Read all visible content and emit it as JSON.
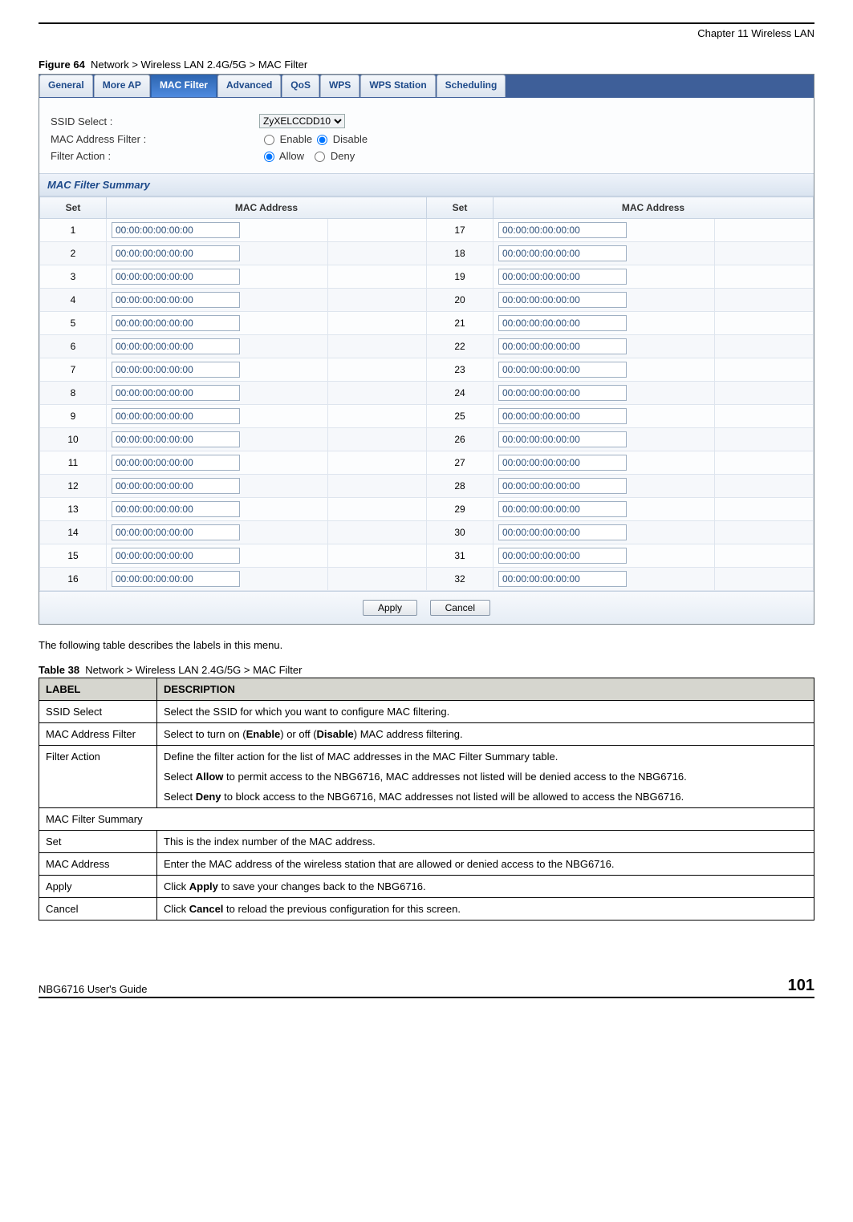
{
  "page": {
    "chapter": "Chapter 11 Wireless LAN",
    "figure_label": "Figure 64",
    "figure_caption": "Network > Wireless LAN 2.4G/5G > MAC Filter",
    "intro_text": "The following table describes the labels in this menu.",
    "table_label": "Table 38",
    "table_caption": "Network > Wireless LAN 2.4G/5G > MAC Filter",
    "footer_left": "NBG6716 User's Guide",
    "page_number": "101"
  },
  "screenshot": {
    "tabs": [
      "General",
      "More AP",
      "MAC Filter",
      "Advanced",
      "QoS",
      "WPS",
      "WPS Station",
      "Scheduling"
    ],
    "active_tab_index": 2,
    "labels": {
      "ssid_select": "SSID Select :",
      "mac_filter": "MAC Address Filter :",
      "filter_action": "Filter Action :",
      "enable": "Enable",
      "disable": "Disable",
      "allow": "Allow",
      "deny": "Deny"
    },
    "ssid_value": "ZyXELCCDD10",
    "mac_filter_value": "Disable",
    "filter_action_value": "Allow",
    "section_title": "MAC Filter Summary",
    "columns": {
      "set": "Set",
      "mac": "MAC Address"
    },
    "mac_rows": [
      {
        "a_set": "1",
        "a_mac": "00:00:00:00:00:00",
        "b_set": "17",
        "b_mac": "00:00:00:00:00:00"
      },
      {
        "a_set": "2",
        "a_mac": "00:00:00:00:00:00",
        "b_set": "18",
        "b_mac": "00:00:00:00:00:00"
      },
      {
        "a_set": "3",
        "a_mac": "00:00:00:00:00:00",
        "b_set": "19",
        "b_mac": "00:00:00:00:00:00"
      },
      {
        "a_set": "4",
        "a_mac": "00:00:00:00:00:00",
        "b_set": "20",
        "b_mac": "00:00:00:00:00:00"
      },
      {
        "a_set": "5",
        "a_mac": "00:00:00:00:00:00",
        "b_set": "21",
        "b_mac": "00:00:00:00:00:00"
      },
      {
        "a_set": "6",
        "a_mac": "00:00:00:00:00:00",
        "b_set": "22",
        "b_mac": "00:00:00:00:00:00"
      },
      {
        "a_set": "7",
        "a_mac": "00:00:00:00:00:00",
        "b_set": "23",
        "b_mac": "00:00:00:00:00:00"
      },
      {
        "a_set": "8",
        "a_mac": "00:00:00:00:00:00",
        "b_set": "24",
        "b_mac": "00:00:00:00:00:00"
      },
      {
        "a_set": "9",
        "a_mac": "00:00:00:00:00:00",
        "b_set": "25",
        "b_mac": "00:00:00:00:00:00"
      },
      {
        "a_set": "10",
        "a_mac": "00:00:00:00:00:00",
        "b_set": "26",
        "b_mac": "00:00:00:00:00:00"
      },
      {
        "a_set": "11",
        "a_mac": "00:00:00:00:00:00",
        "b_set": "27",
        "b_mac": "00:00:00:00:00:00"
      },
      {
        "a_set": "12",
        "a_mac": "00:00:00:00:00:00",
        "b_set": "28",
        "b_mac": "00:00:00:00:00:00"
      },
      {
        "a_set": "13",
        "a_mac": "00:00:00:00:00:00",
        "b_set": "29",
        "b_mac": "00:00:00:00:00:00"
      },
      {
        "a_set": "14",
        "a_mac": "00:00:00:00:00:00",
        "b_set": "30",
        "b_mac": "00:00:00:00:00:00"
      },
      {
        "a_set": "15",
        "a_mac": "00:00:00:00:00:00",
        "b_set": "31",
        "b_mac": "00:00:00:00:00:00"
      },
      {
        "a_set": "16",
        "a_mac": "00:00:00:00:00:00",
        "b_set": "32",
        "b_mac": "00:00:00:00:00:00"
      }
    ],
    "buttons": {
      "apply": "Apply",
      "cancel": "Cancel"
    }
  },
  "desc_table": {
    "headers": {
      "label": "LABEL",
      "description": "DESCRIPTION"
    },
    "rows": [
      {
        "label": "SSID Select",
        "desc": [
          "Select the SSID for which you want to configure MAC filtering."
        ]
      },
      {
        "label": "MAC Address Filter",
        "desc": [
          "Select to turn on (<b>Enable</b>) or off (<b>Disable</b>) MAC address filtering."
        ]
      },
      {
        "label": "Filter Action",
        "desc": [
          "Define the filter action for the list of MAC addresses in the MAC Filter Summary table.",
          "Select <b>Allow</b> to permit access to the NBG6716, MAC addresses not listed will be denied access to the NBG6716.",
          "Select <b>Deny</b> to block access to the NBG6716, MAC addresses not listed will be allowed to access the NBG6716."
        ]
      },
      {
        "label": "MAC Filter Summary",
        "desc": [],
        "span": true
      },
      {
        "label": "Set",
        "desc": [
          "This is the index number of the MAC address."
        ]
      },
      {
        "label": "MAC Address",
        "desc": [
          "Enter the MAC address of the wireless station that are allowed or denied access to the NBG6716."
        ]
      },
      {
        "label": "Apply",
        "desc": [
          "Click <b>Apply</b> to save your changes back to the NBG6716."
        ]
      },
      {
        "label": "Cancel",
        "desc": [
          "Click <b>Cancel</b> to reload the previous configuration for this screen."
        ]
      }
    ]
  }
}
